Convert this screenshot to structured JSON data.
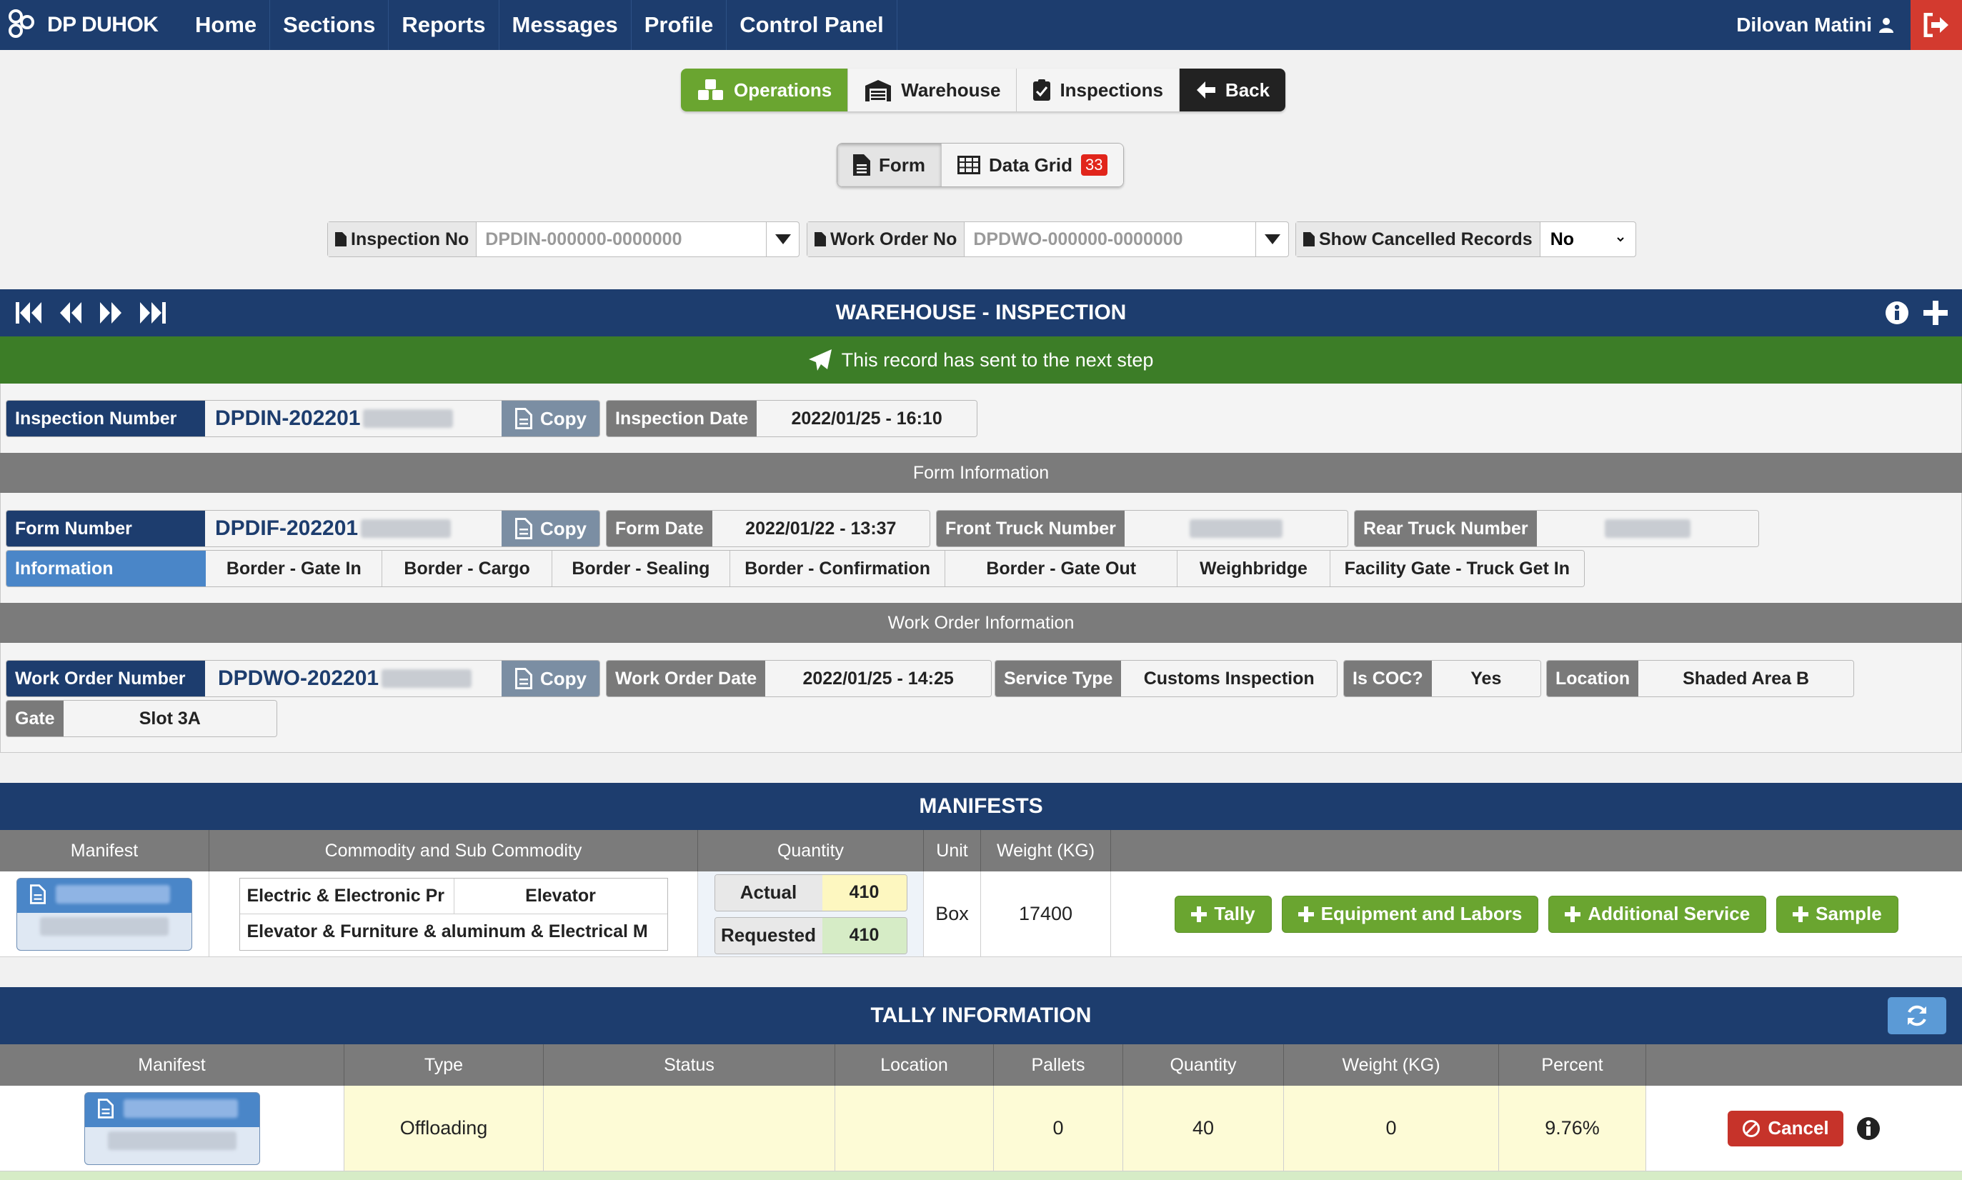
{
  "nav": {
    "brand": "DP DUHOK",
    "items": [
      "Home",
      "Sections",
      "Reports",
      "Messages",
      "Profile",
      "Control Panel"
    ],
    "user": "Dilovan Matini"
  },
  "module_tabs": {
    "operations": "Operations",
    "warehouse": "Warehouse",
    "inspections": "Inspections",
    "back": "Back"
  },
  "view_tabs": {
    "form": "Form",
    "data_grid": "Data Grid",
    "grid_count": "33"
  },
  "filters": {
    "inspection_label": "Inspection No",
    "inspection_placeholder": "DPDIN-000000-0000000",
    "workorder_label": "Work Order No",
    "workorder_placeholder": "DPDWO-000000-0000000",
    "cancelled_label": "Show Cancelled Records",
    "cancelled_value": "No"
  },
  "record": {
    "title": "WAREHOUSE - INSPECTION",
    "status_message": "This record has sent to the next step",
    "inspection_number_label": "Inspection Number",
    "inspection_number": "DPDIN-202201",
    "copy_label": "Copy",
    "inspection_date_label": "Inspection Date",
    "inspection_date": "2022/01/25 - 16:10"
  },
  "form_info": {
    "title": "Form Information",
    "form_number_label": "Form Number",
    "form_number": "DPDIF-202201",
    "form_date_label": "Form Date",
    "form_date": "2022/01/22 - 13:37",
    "front_truck_label": "Front Truck Number",
    "rear_truck_label": "Rear Truck Number",
    "information_label": "Information",
    "steps": [
      "Border - Gate In",
      "Border - Cargo",
      "Border - Sealing",
      "Border - Confirmation",
      "Border - Gate Out",
      "Weighbridge",
      "Facility Gate - Truck Get In"
    ]
  },
  "work_order": {
    "title": "Work Order Information",
    "number_label": "Work Order Number",
    "number": "DPDWO-202201",
    "date_label": "Work Order Date",
    "date": "2022/01/25 - 14:25",
    "service_type_label": "Service Type",
    "service_type": "Customs Inspection",
    "is_coc_label": "Is COC?",
    "is_coc": "Yes",
    "location_label": "Location",
    "location": "Shaded Area B",
    "gate_label": "Gate",
    "gate": "Slot 3A"
  },
  "manifests": {
    "title": "MANIFESTS",
    "headers": [
      "Manifest",
      "Commodity and Sub Commodity",
      "Quantity",
      "Unit",
      "Weight (KG)"
    ],
    "commodity_1": "Electric & Electronic Pr",
    "sub_commodity_1": "Elevator",
    "commodity_2": "Elevator & Furniture & aluminum & Electrical M",
    "actual_label": "Actual",
    "actual": "410",
    "requested_label": "Requested",
    "requested": "410",
    "unit": "Box",
    "weight": "17400",
    "actions": [
      "Tally",
      "Equipment and Labors",
      "Additional Service",
      "Sample"
    ]
  },
  "tally": {
    "title": "TALLY INFORMATION",
    "headers": [
      "Manifest",
      "Type",
      "Status",
      "Location",
      "Pallets",
      "Quantity",
      "Weight (KG)",
      "Percent"
    ],
    "row": {
      "type": "Offloading",
      "status": "",
      "location": "",
      "pallets": "0",
      "quantity": "40",
      "weight": "0",
      "percent": "9.76%"
    },
    "cancel_label": "Cancel"
  },
  "colors": {
    "navy": "#1d3d6e",
    "green": "#6aa530",
    "status_green": "#3c7d27",
    "red": "#c6332a",
    "grey": "#7b7b7b",
    "yellow_cell": "#fdfbd6"
  }
}
